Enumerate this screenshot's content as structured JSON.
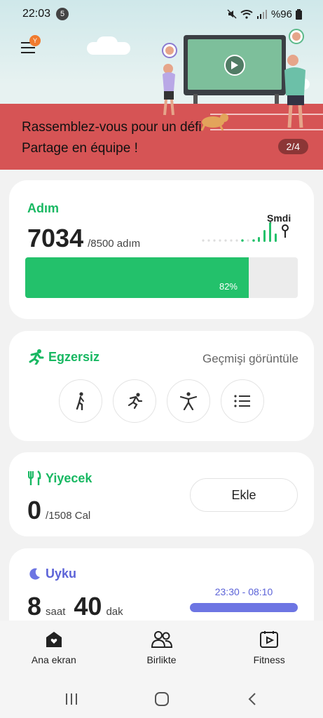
{
  "status_bar": {
    "time": "22:03",
    "notification_count": "5",
    "battery": "%96"
  },
  "banner": {
    "title": "Rassemblez-vous pour un défi Partage en équipe !",
    "page_indicator": "2/4",
    "menu_badge": "Y"
  },
  "steps": {
    "title": "Adım",
    "value": "7034",
    "goal": "/8500 adım",
    "now_label": "Şmdi",
    "progress_label": "82%",
    "progress": 0.82
  },
  "exercise": {
    "title": "Egzersiz",
    "history_link": "Geçmişi görüntüle",
    "buttons": [
      "walking-icon",
      "running-icon",
      "workout-icon",
      "list-icon"
    ]
  },
  "food": {
    "title": "Yiyecek",
    "value": "0",
    "goal": "/1508 Cal",
    "add_label": "Ekle"
  },
  "sleep": {
    "title": "Uyku",
    "hours": "8",
    "hours_unit": "saat",
    "minutes": "40",
    "minutes_unit": "dak",
    "range": "23:30 - 08:10"
  },
  "bottom_nav": {
    "items": [
      {
        "label": "Ana ekran",
        "icon": "home-icon"
      },
      {
        "label": "Birlikte",
        "icon": "people-icon"
      },
      {
        "label": "Fitness",
        "icon": "fitness-icon"
      }
    ]
  },
  "colors": {
    "accent_green": "#18b862",
    "progress_green": "#23c16b",
    "sleep_purple": "#5c63d8",
    "banner_red": "#d65455"
  }
}
